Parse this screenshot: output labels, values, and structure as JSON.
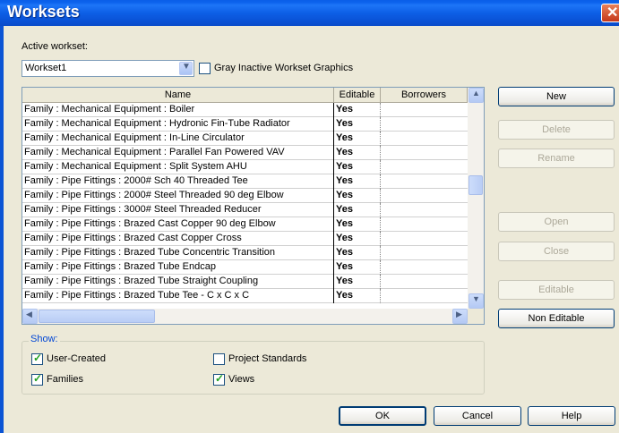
{
  "window": {
    "title": "Worksets"
  },
  "active_workset": {
    "label": "Active workset:",
    "value": "Workset1",
    "gray_inactive_label": "Gray Inactive Workset Graphics",
    "gray_inactive_checked": false
  },
  "table": {
    "columns": [
      "Name",
      "Editable",
      "Borrowers"
    ],
    "rows": [
      {
        "name": "Family  : Mechanical Equipment : Boiler",
        "editable": "Yes",
        "borrowers": ""
      },
      {
        "name": "Family  : Mechanical Equipment : Hydronic Fin-Tube Radiator",
        "editable": "Yes",
        "borrowers": ""
      },
      {
        "name": "Family  : Mechanical Equipment : In-Line Circulator",
        "editable": "Yes",
        "borrowers": ""
      },
      {
        "name": "Family  : Mechanical Equipment : Parallel Fan Powered VAV",
        "editable": "Yes",
        "borrowers": ""
      },
      {
        "name": "Family  : Mechanical Equipment : Split System AHU",
        "editable": "Yes",
        "borrowers": ""
      },
      {
        "name": "Family  : Pipe Fittings : 2000# Sch 40 Threaded Tee",
        "editable": "Yes",
        "borrowers": ""
      },
      {
        "name": "Family  : Pipe Fittings : 2000# Steel Threaded 90 deg Elbow",
        "editable": "Yes",
        "borrowers": ""
      },
      {
        "name": "Family  : Pipe Fittings : 3000# Steel Threaded Reducer",
        "editable": "Yes",
        "borrowers": ""
      },
      {
        "name": "Family  : Pipe Fittings : Brazed Cast Copper 90 deg Elbow",
        "editable": "Yes",
        "borrowers": ""
      },
      {
        "name": "Family  : Pipe Fittings : Brazed Cast Copper Cross",
        "editable": "Yes",
        "borrowers": ""
      },
      {
        "name": "Family  : Pipe Fittings : Brazed Tube Concentric Transition",
        "editable": "Yes",
        "borrowers": ""
      },
      {
        "name": "Family  : Pipe Fittings : Brazed Tube Endcap",
        "editable": "Yes",
        "borrowers": ""
      },
      {
        "name": "Family  : Pipe Fittings : Brazed Tube Straight Coupling",
        "editable": "Yes",
        "borrowers": ""
      },
      {
        "name": "Family  : Pipe Fittings : Brazed Tube Tee - C x C x C",
        "editable": "Yes",
        "borrowers": ""
      }
    ]
  },
  "buttons": {
    "new": "New",
    "delete": "Delete",
    "rename": "Rename",
    "open": "Open",
    "close": "Close",
    "editable": "Editable",
    "non_editable": "Non Editable",
    "ok": "OK",
    "cancel": "Cancel",
    "help": "Help"
  },
  "show": {
    "label": "Show:",
    "user_created": {
      "label": "User-Created",
      "checked": true
    },
    "families": {
      "label": "Families",
      "checked": true
    },
    "project_standards": {
      "label": "Project Standards",
      "checked": false
    },
    "views": {
      "label": "Views",
      "checked": true
    }
  }
}
